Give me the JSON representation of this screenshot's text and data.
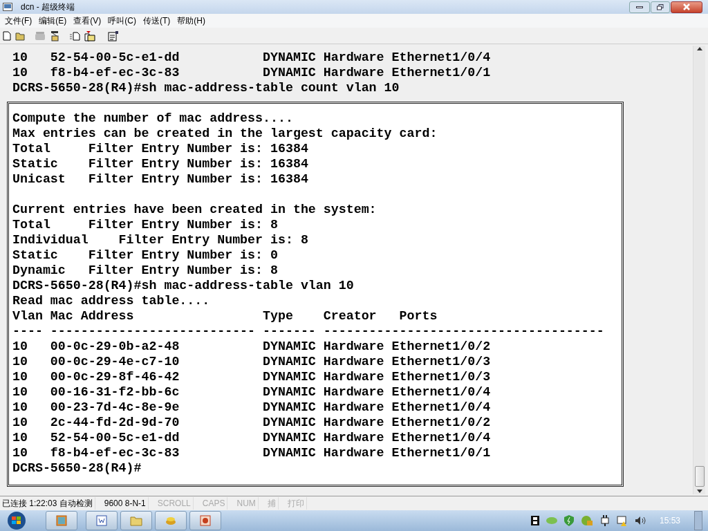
{
  "window": {
    "title": "dcn - 超级终端"
  },
  "menu": [
    "文件(F)",
    "编辑(E)",
    "查看(V)",
    "呼叫(C)",
    "传送(T)",
    "帮助(H)"
  ],
  "terminal": {
    "lines": [
      "10   52-54-00-5c-e1-dd           DYNAMIC Hardware Ethernet1/0/4",
      "10   f8-b4-ef-ec-3c-83           DYNAMIC Hardware Ethernet1/0/1",
      "DCRS-5650-28(R4)#sh mac-address-table count vlan 10"
    ],
    "inset_blocks": [
      [
        "Compute the number of mac address....",
        "Max entries can be created in the largest capacity card:",
        "Total     Filter Entry Number is: 16384",
        "Static    Filter Entry Number is: 16384",
        "Unicast   Filter Entry Number is: 16384"
      ],
      [
        "Current entries have been created in the system:",
        "Total     Filter Entry Number is: 8",
        "Individual    Filter Entry Number is: 8",
        "Static    Filter Entry Number is: 0",
        "Dynamic   Filter Entry Number is: 8",
        "DCRS-5650-28(R4)#sh mac-address-table vlan 10",
        "Read mac address table....",
        "Vlan Mac Address                 Type    Creator   Ports",
        "---- --------------------------- ------- -------------------------------------",
        "10   00-0c-29-0b-a2-48           DYNAMIC Hardware Ethernet1/0/2",
        "10   00-0c-29-4e-c7-10           DYNAMIC Hardware Ethernet1/0/3",
        "10   00-0c-29-8f-46-42           DYNAMIC Hardware Ethernet1/0/3",
        "10   00-16-31-f2-bb-6c           DYNAMIC Hardware Ethernet1/0/4",
        "10   00-23-7d-4c-8e-9e           DYNAMIC Hardware Ethernet1/0/4",
        "10   2c-44-fd-2d-9d-70           DYNAMIC Hardware Ethernet1/0/2",
        "10   52-54-00-5c-e1-dd           DYNAMIC Hardware Ethernet1/0/4",
        "10   f8-b4-ef-ec-3c-83           DYNAMIC Hardware Ethernet1/0/1",
        "DCRS-5650-28(R4)#"
      ]
    ]
  },
  "status_bar": [
    {
      "text": "已连接 1:22:03 自动检测",
      "disabled": false
    },
    {
      "text": "9600 8-N-1",
      "disabled": false
    },
    {
      "text": "SCROLL",
      "disabled": true
    },
    {
      "text": "CAPS",
      "disabled": true
    },
    {
      "text": "NUM",
      "disabled": true
    },
    {
      "text": "捕",
      "disabled": true
    },
    {
      "text": "打印",
      "disabled": true
    }
  ],
  "taskbar": {
    "clock": "15:53"
  }
}
